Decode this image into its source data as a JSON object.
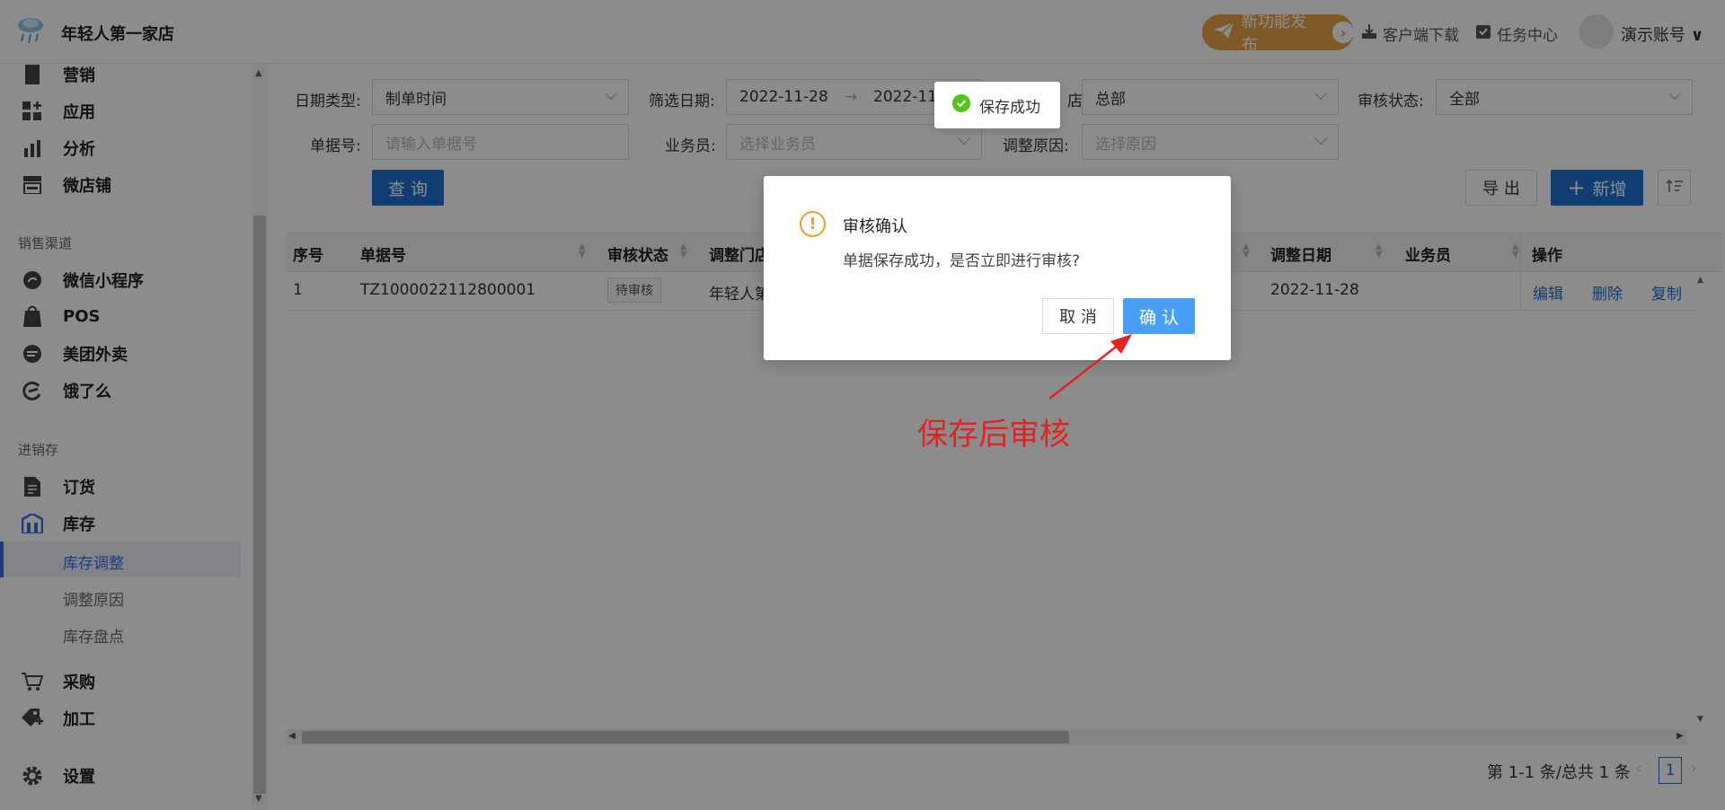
{
  "header": {
    "store_name": "年轻人第一家店",
    "promo_label": "新功能发布",
    "download_label": "客户端下载",
    "tasks_label": "任务中心",
    "user_label": "演示账号"
  },
  "sidebar": {
    "top_items": [
      {
        "label": "营销",
        "icon": "marketing-icon"
      },
      {
        "label": "应用",
        "icon": "apps-icon"
      },
      {
        "label": "分析",
        "icon": "chart-icon"
      },
      {
        "label": "微店铺",
        "icon": "shop-icon"
      }
    ],
    "group_sales": "销售渠道",
    "sales_items": [
      {
        "label": "微信小程序",
        "icon": "miniprogram-icon"
      },
      {
        "label": "POS",
        "icon": "pos-icon"
      },
      {
        "label": "美团外卖",
        "icon": "meituan-icon"
      },
      {
        "label": "饿了么",
        "icon": "eleme-icon"
      }
    ],
    "group_inventory": "进销存",
    "inventory_items": [
      {
        "label": "订货",
        "icon": "order-icon"
      },
      {
        "label": "库存",
        "icon": "warehouse-icon"
      }
    ],
    "sub_items": [
      {
        "label": "库存调整",
        "active": true
      },
      {
        "label": "调整原因",
        "active": false
      },
      {
        "label": "库存盘点",
        "active": false
      }
    ],
    "bottom_items": [
      {
        "label": "采购",
        "icon": "cart-icon"
      },
      {
        "label": "加工",
        "icon": "tag-icon"
      },
      {
        "label": "设置",
        "icon": "gear-icon"
      }
    ]
  },
  "filters": {
    "date_type_label": "日期类型:",
    "date_type_value": "制单时间",
    "date_range_label": "筛选日期:",
    "date_start": "2022-11-28",
    "date_end": "2022-11-2",
    "store_label": "店",
    "store_value": "总部",
    "audit_label": "审核状态:",
    "audit_value": "全部",
    "doc_no_label": "单据号:",
    "doc_no_placeholder": "请输入单据号",
    "staff_label": "业务员:",
    "staff_placeholder": "选择业务员",
    "reason_label": "调整原因:",
    "reason_placeholder": "选择原因",
    "query_button": "查 询",
    "export_button": "导 出",
    "add_button": "新增"
  },
  "table": {
    "columns": [
      "序号",
      "单据号",
      "审核状态",
      "调整门店",
      "调整日期",
      "业务员",
      "操作"
    ],
    "rows": [
      {
        "index": "1",
        "doc_no": "TZ1000022112800001",
        "status": "待审核",
        "store": "年轻人第",
        "date": "2022-11-28",
        "staff": "",
        "ops": [
          "编辑",
          "删除",
          "复制"
        ]
      }
    ]
  },
  "pagination": {
    "summary": "第 1-1 条/总共 1 条",
    "current_page": "1"
  },
  "toast": {
    "message": "保存成功"
  },
  "modal": {
    "title": "审核确认",
    "body": "单据保存成功，是否立即进行审核?",
    "cancel": "取 消",
    "confirm": "确 认"
  },
  "annotation": {
    "text": "保存后审核",
    "color": "#e32222"
  },
  "colors": {
    "primary": "#1f6fd0",
    "promo": "#e9a24a",
    "success": "#52c41a",
    "warning": "#f0a020",
    "confirm": "#4a9ff5"
  }
}
